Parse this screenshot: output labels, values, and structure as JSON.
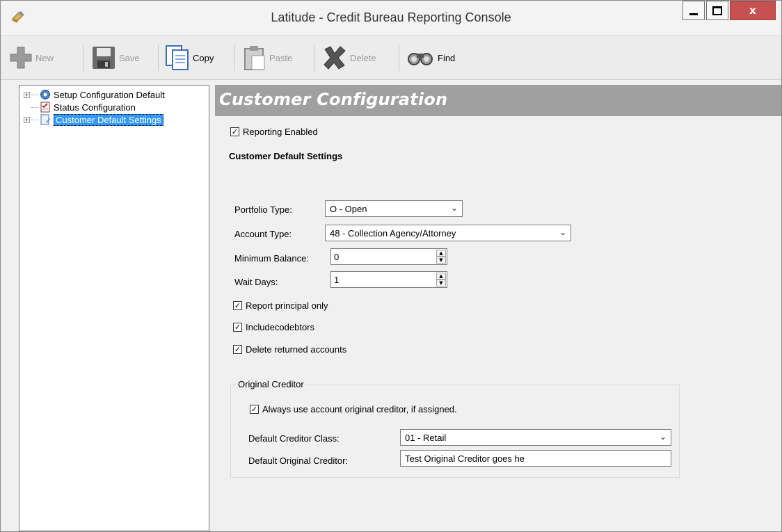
{
  "window": {
    "title": "Latitude - Credit Bureau Reporting Console",
    "close_glyph": "x"
  },
  "toolbar": {
    "new_label": "New",
    "save_label": "Save",
    "copy_label": "Copy",
    "paste_label": "Paste",
    "delete_label": "Delete",
    "find_label": "Find"
  },
  "tree": {
    "items": [
      {
        "label": "Setup Configuration Default",
        "icon": "gear-globe-icon"
      },
      {
        "label": "Status Configuration",
        "icon": "checklist-icon"
      },
      {
        "label": "Customer Default Settings",
        "icon": "document-edit-icon",
        "selected": true
      }
    ]
  },
  "header": {
    "title": "Customer Configuration"
  },
  "form": {
    "reporting_enabled_label": "Reporting Enabled",
    "section_title": "Customer Default Settings",
    "portfolio_type_label": "Portfolio Type:",
    "portfolio_type_value": "O - Open",
    "account_type_label": "Account Type:",
    "account_type_value": "48 - Collection Agency/Attorney",
    "minimum_balance_label": "Minimum Balance:",
    "minimum_balance_value": "0",
    "wait_days_label": "Wait Days:",
    "wait_days_value": "1",
    "report_principal_label": "Report principal only",
    "include_codebtors_label": "Includecodebtors",
    "delete_returned_label": "Delete returned accounts"
  },
  "original_creditor": {
    "group_title": "Original Creditor",
    "always_use_label": "Always use account original creditor, if assigned.",
    "creditor_class_label": "Default Creditor Class:",
    "creditor_class_value": "01 - Retail",
    "original_creditor_label": "Default Original Creditor:",
    "original_creditor_value": "Test Original Creditor goes he"
  },
  "colors": {
    "header_band": "#a0a0a0",
    "close_button": "#c75050",
    "selection": "#3399ff"
  }
}
